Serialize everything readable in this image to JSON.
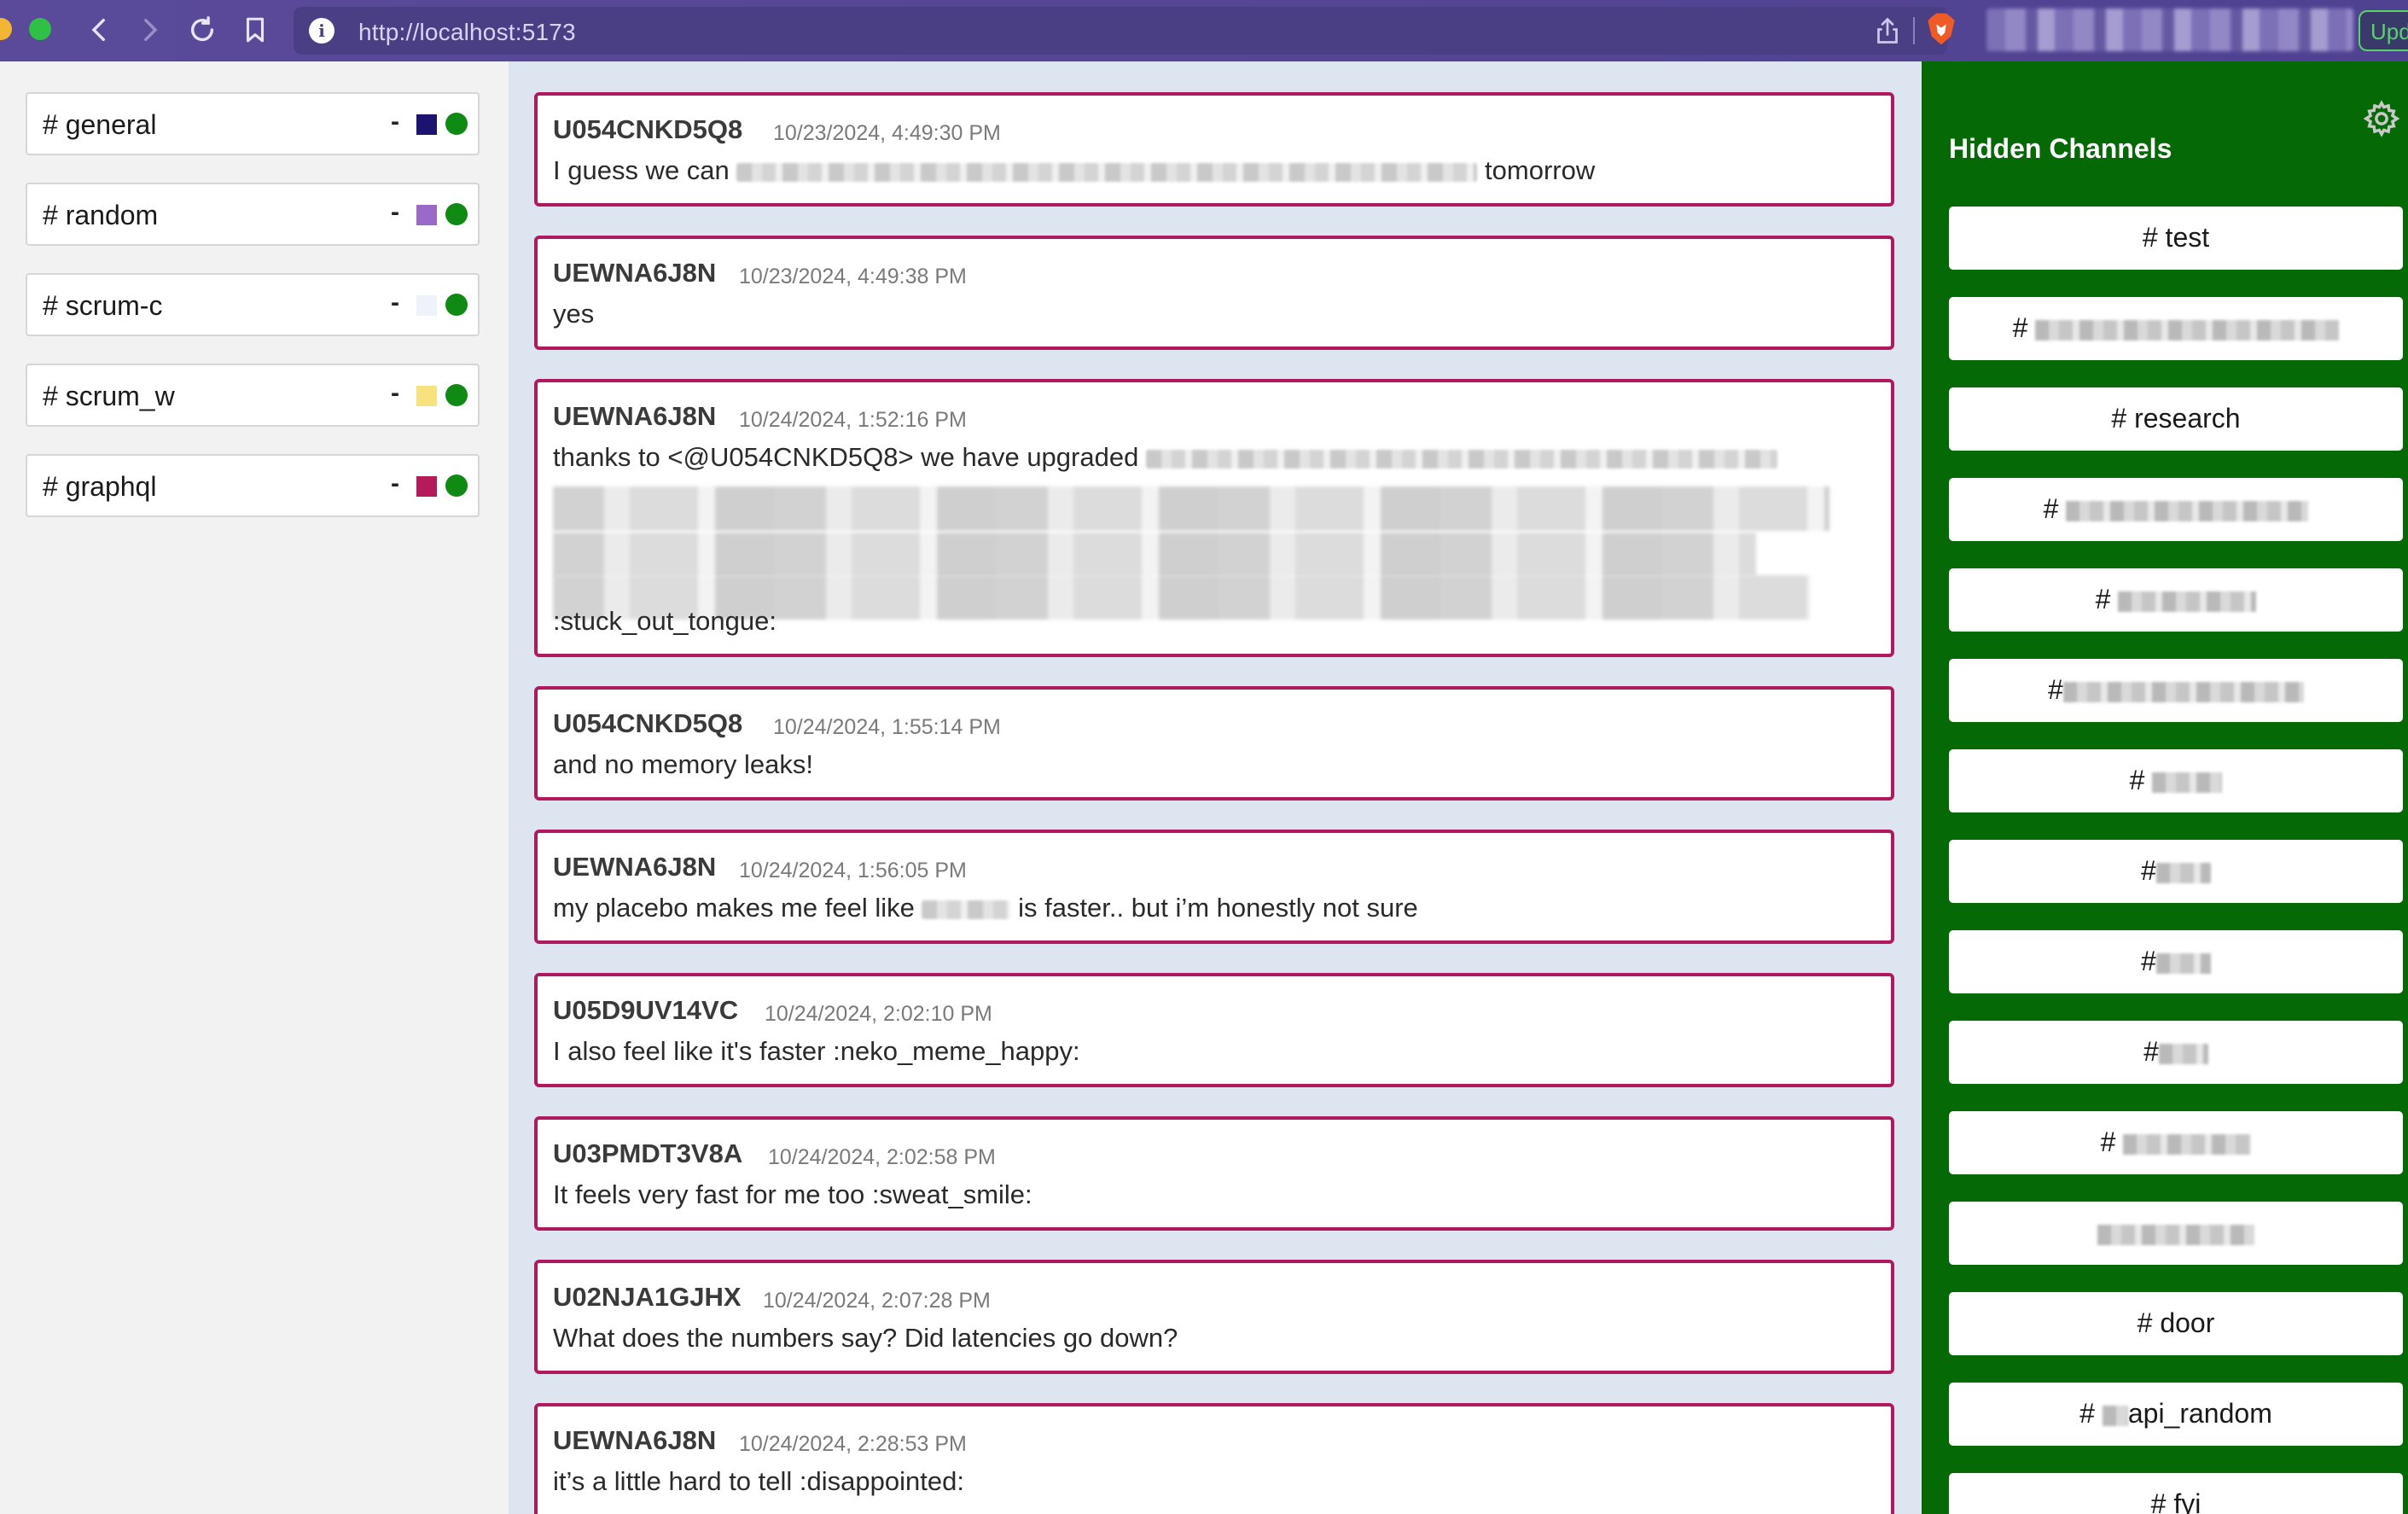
{
  "browser": {
    "url": "http://localhost:5173",
    "update_label": "Upd"
  },
  "channels": [
    {
      "label": "# general",
      "dash": "-",
      "swatch": "#1c1370"
    },
    {
      "label": "# random",
      "dash": "-",
      "swatch": "#9b6ac9"
    },
    {
      "label": "# scrum-c",
      "dash": "-",
      "swatch": "#eef3fb"
    },
    {
      "label": "# scrum_w",
      "dash": "-",
      "swatch": "#f7e27e"
    },
    {
      "label": "# graphql",
      "dash": "-",
      "swatch": "#b51a5a"
    }
  ],
  "messages": [
    {
      "user": "U054CNKD5Q8",
      "time": "10/23/2024, 4:49:30 PM",
      "text_before": "I guess we can",
      "text_after": "tomorrow"
    },
    {
      "user": "UEWNA6J8N",
      "time": "10/23/2024, 4:49:38 PM",
      "text": "yes"
    },
    {
      "user": "UEWNA6J8N",
      "time": "10/24/2024, 1:52:16 PM",
      "text": "thanks to <@U054CNKD5Q8> we have upgraded",
      "text_end": ":stuck_out_tongue:"
    },
    {
      "user": "U054CNKD5Q8",
      "time": "10/24/2024, 1:55:14 PM",
      "text": "and no memory leaks!"
    },
    {
      "user": "UEWNA6J8N",
      "time": "10/24/2024, 1:56:05 PM",
      "text_before": "my placebo makes me feel like",
      "text_after": "is faster.. but i’m honestly not sure"
    },
    {
      "user": "U05D9UV14VC",
      "time": "10/24/2024, 2:02:10 PM",
      "text": "I also feel like it's faster :neko_meme_happy:"
    },
    {
      "user": "U03PMDT3V8A",
      "time": "10/24/2024, 2:02:58 PM",
      "text": "It feels very fast for me too :sweat_smile:"
    },
    {
      "user": "U02NJA1GJHX",
      "time": "10/24/2024, 2:07:28 PM",
      "text": "What does the numbers say? Did latencies go down?"
    },
    {
      "user": "UEWNA6J8N",
      "time": "10/24/2024, 2:28:53 PM",
      "text": "it’s a little hard to tell :disappointed:"
    }
  ],
  "hidden_panel": {
    "title": "Hidden Channels",
    "settings_icon": "gear-icon",
    "channels": [
      {
        "label": "# test"
      },
      {
        "label": "#",
        "redacted": true
      },
      {
        "label": "# research"
      },
      {
        "label": "#",
        "redacted": true
      },
      {
        "label": "#",
        "redacted": true
      },
      {
        "label": "#",
        "redacted": true
      },
      {
        "label": "#",
        "redacted": true
      },
      {
        "label": "#",
        "redacted": true
      },
      {
        "label": "#",
        "redacted": true
      },
      {
        "label": "#",
        "redacted": true
      },
      {
        "label": "#",
        "redacted": true
      },
      {
        "label": "",
        "redacted": true
      },
      {
        "label": "# door"
      },
      {
        "label": "#",
        "suffix": "api_random"
      },
      {
        "label": "# fyi"
      }
    ]
  },
  "colors": {
    "chrome": "#5b4a9a",
    "message_border": "#b0195f",
    "hidden_panel_bg": "#056a05",
    "status_dot": "#0f8a12"
  }
}
